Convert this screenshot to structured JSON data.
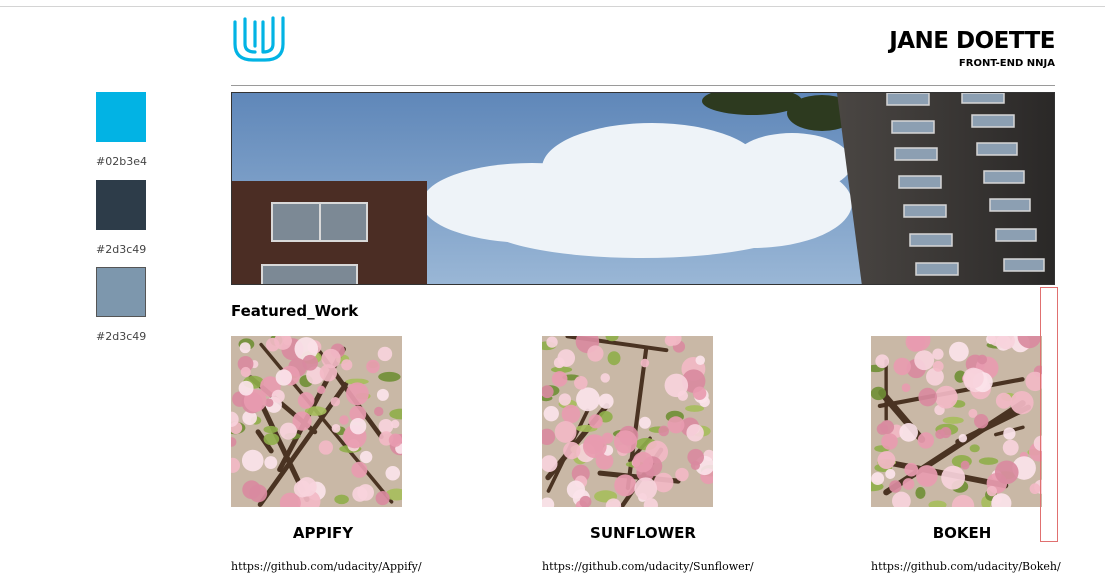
{
  "palette": [
    {
      "color": "#02b3e4",
      "label": "#02b3e4"
    },
    {
      "color": "#2d3c49",
      "label": "#2d3c49"
    },
    {
      "color": "#7d97ad",
      "label": "#2d3c49"
    }
  ],
  "header": {
    "logo_icon": "udacity-logo-icon",
    "logo_color": "#02b3e4",
    "name": "JANE DOETTE",
    "subtitle": "FRONT-END NNJA"
  },
  "hero": {
    "image": "sky-and-buildings-photo"
  },
  "featured": {
    "title": "Featured_Work",
    "projects": [
      {
        "title": "APPIFY",
        "link": "https://github.com/udacity/Appify/",
        "image": "cherry-blossom-photo"
      },
      {
        "title": "SUNFLOWER",
        "link": "https://github.com/udacity/Sunflower/",
        "image": "cherry-blossom-photo"
      },
      {
        "title": "BOKEH",
        "link": "https://github.com/udacity/Bokeh/",
        "image": "cherry-blossom-photo"
      }
    ]
  }
}
